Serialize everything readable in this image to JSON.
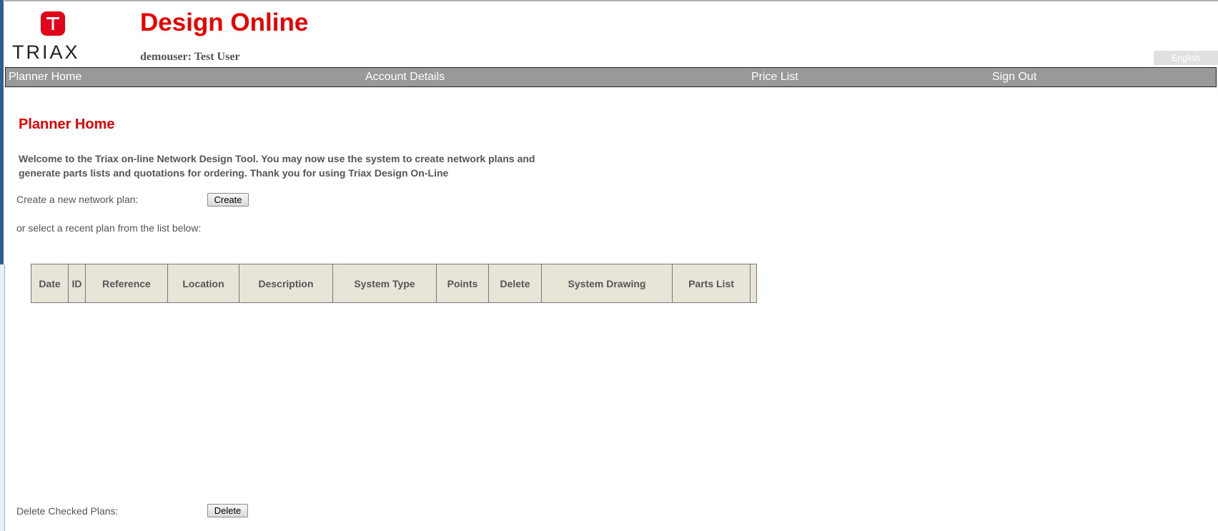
{
  "header": {
    "logo_text": "TRIAX",
    "logo_mark": "T",
    "app_title": "Design Online",
    "user_line": "demouser: Test User",
    "language_button": "English"
  },
  "nav": {
    "items": [
      {
        "label": "Planner Home"
      },
      {
        "label": "Account Details"
      },
      {
        "label": "Price List"
      },
      {
        "label": "Sign Out"
      }
    ]
  },
  "main": {
    "title": "Planner Home",
    "welcome_text": "Welcome to the Triax on-line Network Design Tool. You may now use the system to create network plans and generate parts lists and quotations for ordering. Thank you for using Triax Design On-Line",
    "create_label": "Create a new network plan:",
    "create_button": "Create",
    "select_label": "or select a recent plan from the list below:",
    "delete_label": "Delete Checked Plans:",
    "delete_button": "Delete"
  },
  "table": {
    "columns": [
      "Date",
      "ID",
      "Reference",
      "Location",
      "Description",
      "System Type",
      "Points",
      "Delete",
      "System Drawing",
      "Parts List"
    ],
    "rows": []
  },
  "colors": {
    "brand_red": "#e60000",
    "nav_bg": "#999999",
    "table_header_bg": "#e8e4d8"
  }
}
